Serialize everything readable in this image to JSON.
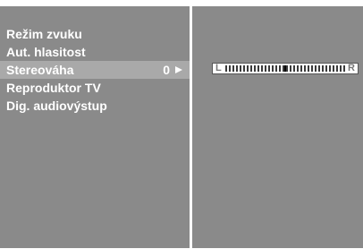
{
  "menu": {
    "items": [
      {
        "label": "Režim zvuku"
      },
      {
        "label": "Aut. hlasitost"
      },
      {
        "label": "Stereováha",
        "value": "0",
        "selected": true
      },
      {
        "label": "Reproduktor TV"
      },
      {
        "label": "Dig. audiovýstup"
      }
    ]
  },
  "balance": {
    "left_label": "L",
    "right_label": "R",
    "value": 0
  },
  "colors": {
    "panel": "#8a8a8a",
    "highlight": "#a9a9a9",
    "text": "#ffffff"
  },
  "icons": {
    "selected_item_arrow": "right-triangle-icon"
  }
}
